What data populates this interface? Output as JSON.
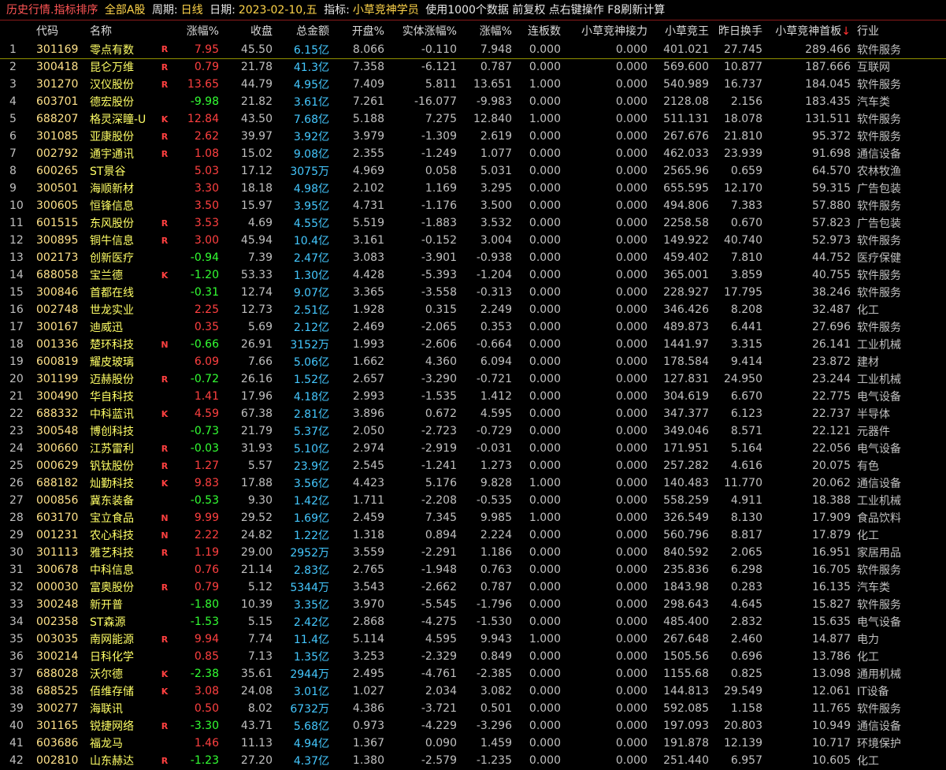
{
  "title_bar": {
    "history": "历史行情.指标排序",
    "market": "全部A股",
    "period_label": "周期:",
    "period_value": "日线",
    "date_label": "日期:",
    "date_value": "2023-02-10,五",
    "indicator_label": "指标:",
    "indicator_value": "小草竞神学员",
    "info": "使用1000个数据 前复权 点右键操作 F8刷新计算"
  },
  "columns": [
    "",
    "代码",
    "名称",
    "",
    "涨幅%",
    "收盘",
    "总金额",
    "开盘%",
    "实体涨幅%",
    "涨幅%",
    "连板数",
    "小草竞神接力",
    "小草竞王",
    "昨日换手",
    "小草竞神首板",
    "行业"
  ],
  "sort_indicator": "↓",
  "rows": [
    [
      "1",
      "301169",
      "零点有数",
      "R",
      "7.95",
      "45.50",
      "6.15亿",
      "8.066",
      "-0.110",
      "7.948",
      "0.000",
      "0.000",
      "401.021",
      "27.745",
      "289.466",
      "软件服务"
    ],
    [
      "2",
      "300418",
      "昆仑万维",
      "R",
      "0.79",
      "21.78",
      "41.3亿",
      "7.358",
      "-6.121",
      "0.787",
      "0.000",
      "0.000",
      "569.600",
      "10.877",
      "187.666",
      "互联网"
    ],
    [
      "3",
      "301270",
      "汉仪股份",
      "R",
      "13.65",
      "44.79",
      "4.95亿",
      "7.409",
      "5.811",
      "13.651",
      "1.000",
      "0.000",
      "540.989",
      "16.737",
      "184.045",
      "软件服务"
    ],
    [
      "4",
      "603701",
      "德宏股份",
      "",
      "-9.98",
      "21.82",
      "3.61亿",
      "7.261",
      "-16.077",
      "-9.983",
      "0.000",
      "0.000",
      "2128.08",
      "2.156",
      "183.435",
      "汽车类"
    ],
    [
      "5",
      "688207",
      "格灵深瞳-U",
      "K",
      "12.84",
      "43.50",
      "7.68亿",
      "5.188",
      "7.275",
      "12.840",
      "1.000",
      "0.000",
      "511.131",
      "18.078",
      "131.511",
      "软件服务"
    ],
    [
      "6",
      "301085",
      "亚康股份",
      "R",
      "2.62",
      "39.97",
      "3.92亿",
      "3.979",
      "-1.309",
      "2.619",
      "0.000",
      "0.000",
      "267.676",
      "21.810",
      "95.372",
      "软件服务"
    ],
    [
      "7",
      "002792",
      "通宇通讯",
      "R",
      "1.08",
      "15.02",
      "9.08亿",
      "2.355",
      "-1.249",
      "1.077",
      "0.000",
      "0.000",
      "462.033",
      "23.939",
      "91.698",
      "通信设备"
    ],
    [
      "8",
      "600265",
      "ST景谷",
      "",
      "5.03",
      "17.12",
      "3075万",
      "4.969",
      "0.058",
      "5.031",
      "0.000",
      "0.000",
      "2565.96",
      "0.659",
      "64.570",
      "农林牧渔"
    ],
    [
      "9",
      "300501",
      "海顺新材",
      "",
      "3.30",
      "18.18",
      "4.98亿",
      "2.102",
      "1.169",
      "3.295",
      "0.000",
      "0.000",
      "655.595",
      "12.170",
      "59.315",
      "广告包装"
    ],
    [
      "10",
      "300605",
      "恒锋信息",
      "",
      "3.50",
      "15.97",
      "3.95亿",
      "4.731",
      "-1.176",
      "3.500",
      "0.000",
      "0.000",
      "494.806",
      "7.383",
      "57.880",
      "软件服务"
    ],
    [
      "11",
      "601515",
      "东风股份",
      "R",
      "3.53",
      "4.69",
      "4.55亿",
      "5.519",
      "-1.883",
      "3.532",
      "0.000",
      "0.000",
      "2258.58",
      "0.670",
      "57.823",
      "广告包装"
    ],
    [
      "12",
      "300895",
      "铜牛信息",
      "R",
      "3.00",
      "45.94",
      "10.4亿",
      "3.161",
      "-0.152",
      "3.004",
      "0.000",
      "0.000",
      "149.922",
      "40.740",
      "52.973",
      "软件服务"
    ],
    [
      "13",
      "002173",
      "创新医疗",
      "",
      "-0.94",
      "7.39",
      "2.47亿",
      "3.083",
      "-3.901",
      "-0.938",
      "0.000",
      "0.000",
      "459.402",
      "7.810",
      "44.752",
      "医疗保健"
    ],
    [
      "14",
      "688058",
      "宝兰德",
      "K",
      "-1.20",
      "53.33",
      "1.30亿",
      "4.428",
      "-5.393",
      "-1.204",
      "0.000",
      "0.000",
      "365.001",
      "3.859",
      "40.755",
      "软件服务"
    ],
    [
      "15",
      "300846",
      "首都在线",
      "",
      "-0.31",
      "12.74",
      "9.07亿",
      "3.365",
      "-3.558",
      "-0.313",
      "0.000",
      "0.000",
      "228.927",
      "17.795",
      "38.246",
      "软件服务"
    ],
    [
      "16",
      "002748",
      "世龙实业",
      "",
      "2.25",
      "12.73",
      "2.51亿",
      "1.928",
      "0.315",
      "2.249",
      "0.000",
      "0.000",
      "346.426",
      "8.208",
      "32.487",
      "化工"
    ],
    [
      "17",
      "300167",
      "迪威迅",
      "",
      "0.35",
      "5.69",
      "2.12亿",
      "2.469",
      "-2.065",
      "0.353",
      "0.000",
      "0.000",
      "489.873",
      "6.441",
      "27.696",
      "软件服务"
    ],
    [
      "18",
      "001336",
      "楚环科技",
      "N",
      "-0.66",
      "26.91",
      "3152万",
      "1.993",
      "-2.606",
      "-0.664",
      "0.000",
      "0.000",
      "1441.97",
      "3.315",
      "26.141",
      "工业机械"
    ],
    [
      "19",
      "600819",
      "耀皮玻璃",
      "",
      "6.09",
      "7.66",
      "5.06亿",
      "1.662",
      "4.360",
      "6.094",
      "0.000",
      "0.000",
      "178.584",
      "9.414",
      "23.872",
      "建材"
    ],
    [
      "20",
      "301199",
      "迈赫股份",
      "R",
      "-0.72",
      "26.16",
      "1.52亿",
      "2.657",
      "-3.290",
      "-0.721",
      "0.000",
      "0.000",
      "127.831",
      "24.950",
      "23.244",
      "工业机械"
    ],
    [
      "21",
      "300490",
      "华自科技",
      "",
      "1.41",
      "17.96",
      "4.18亿",
      "2.993",
      "-1.535",
      "1.412",
      "0.000",
      "0.000",
      "304.619",
      "6.670",
      "22.775",
      "电气设备"
    ],
    [
      "22",
      "688332",
      "中科蓝讯",
      "K",
      "4.59",
      "67.38",
      "2.81亿",
      "3.896",
      "0.672",
      "4.595",
      "0.000",
      "0.000",
      "347.377",
      "6.123",
      "22.737",
      "半导体"
    ],
    [
      "23",
      "300548",
      "博创科技",
      "",
      "-0.73",
      "21.79",
      "5.37亿",
      "2.050",
      "-2.723",
      "-0.729",
      "0.000",
      "0.000",
      "349.046",
      "8.571",
      "22.121",
      "元器件"
    ],
    [
      "24",
      "300660",
      "江苏雷利",
      "R",
      "-0.03",
      "31.93",
      "5.10亿",
      "2.974",
      "-2.919",
      "-0.031",
      "0.000",
      "0.000",
      "171.951",
      "5.164",
      "22.056",
      "电气设备"
    ],
    [
      "25",
      "000629",
      "钒钛股份",
      "R",
      "1.27",
      "5.57",
      "23.9亿",
      "2.545",
      "-1.241",
      "1.273",
      "0.000",
      "0.000",
      "257.282",
      "4.616",
      "20.075",
      "有色"
    ],
    [
      "26",
      "688182",
      "灿勤科技",
      "K",
      "9.83",
      "17.88",
      "3.56亿",
      "4.423",
      "5.176",
      "9.828",
      "1.000",
      "0.000",
      "140.483",
      "11.770",
      "20.062",
      "通信设备"
    ],
    [
      "27",
      "000856",
      "冀东装备",
      "",
      "-0.53",
      "9.30",
      "1.42亿",
      "1.711",
      "-2.208",
      "-0.535",
      "0.000",
      "0.000",
      "558.259",
      "4.911",
      "18.388",
      "工业机械"
    ],
    [
      "28",
      "603170",
      "宝立食品",
      "N",
      "9.99",
      "29.52",
      "1.69亿",
      "2.459",
      "7.345",
      "9.985",
      "1.000",
      "0.000",
      "326.549",
      "8.130",
      "17.909",
      "食品饮料"
    ],
    [
      "29",
      "001231",
      "农心科技",
      "N",
      "2.22",
      "24.82",
      "1.22亿",
      "1.318",
      "0.894",
      "2.224",
      "0.000",
      "0.000",
      "560.796",
      "8.817",
      "17.879",
      "化工"
    ],
    [
      "30",
      "301113",
      "雅艺科技",
      "R",
      "1.19",
      "29.00",
      "2952万",
      "3.559",
      "-2.291",
      "1.186",
      "0.000",
      "0.000",
      "840.592",
      "2.065",
      "16.951",
      "家居用品"
    ],
    [
      "31",
      "300678",
      "中科信息",
      "",
      "0.76",
      "21.14",
      "2.83亿",
      "2.765",
      "-1.948",
      "0.763",
      "0.000",
      "0.000",
      "235.836",
      "6.298",
      "16.705",
      "软件服务"
    ],
    [
      "32",
      "000030",
      "富奥股份",
      "R",
      "0.79",
      "5.12",
      "5344万",
      "3.543",
      "-2.662",
      "0.787",
      "0.000",
      "0.000",
      "1843.98",
      "0.283",
      "16.135",
      "汽车类"
    ],
    [
      "33",
      "300248",
      "新开普",
      "",
      "-1.80",
      "10.39",
      "3.35亿",
      "3.970",
      "-5.545",
      "-1.796",
      "0.000",
      "0.000",
      "298.643",
      "4.645",
      "15.827",
      "软件服务"
    ],
    [
      "34",
      "002358",
      "ST森源",
      "",
      "-1.53",
      "5.15",
      "2.42亿",
      "2.868",
      "-4.275",
      "-1.530",
      "0.000",
      "0.000",
      "485.400",
      "2.832",
      "15.635",
      "电气设备"
    ],
    [
      "35",
      "003035",
      "南网能源",
      "R",
      "9.94",
      "7.74",
      "11.4亿",
      "5.114",
      "4.595",
      "9.943",
      "1.000",
      "0.000",
      "267.648",
      "2.460",
      "14.877",
      "电力"
    ],
    [
      "36",
      "300214",
      "日科化学",
      "",
      "0.85",
      "7.13",
      "1.35亿",
      "3.253",
      "-2.329",
      "0.849",
      "0.000",
      "0.000",
      "1505.56",
      "0.696",
      "13.786",
      "化工"
    ],
    [
      "37",
      "688028",
      "沃尔德",
      "K",
      "-2.38",
      "35.61",
      "2944万",
      "2.495",
      "-4.761",
      "-2.385",
      "0.000",
      "0.000",
      "1155.68",
      "0.825",
      "13.098",
      "通用机械"
    ],
    [
      "38",
      "688525",
      "佰维存储",
      "K",
      "3.08",
      "24.08",
      "3.01亿",
      "1.027",
      "2.034",
      "3.082",
      "0.000",
      "0.000",
      "144.813",
      "29.549",
      "12.061",
      "IT设备"
    ],
    [
      "39",
      "300277",
      "海联讯",
      "",
      "0.50",
      "8.02",
      "6732万",
      "4.386",
      "-3.721",
      "0.501",
      "0.000",
      "0.000",
      "592.085",
      "1.158",
      "11.765",
      "软件服务"
    ],
    [
      "40",
      "301165",
      "锐捷网络",
      "R",
      "-3.30",
      "43.71",
      "5.68亿",
      "0.973",
      "-4.229",
      "-3.296",
      "0.000",
      "0.000",
      "197.093",
      "20.803",
      "10.949",
      "通信设备"
    ],
    [
      "41",
      "603686",
      "福龙马",
      "",
      "1.46",
      "11.13",
      "4.94亿",
      "1.367",
      "0.090",
      "1.459",
      "0.000",
      "0.000",
      "191.878",
      "12.139",
      "10.717",
      "环境保护"
    ],
    [
      "42",
      "002810",
      "山东赫达",
      "R",
      "-1.23",
      "27.20",
      "4.37亿",
      "1.380",
      "-2.579",
      "-1.235",
      "0.000",
      "0.000",
      "251.440",
      "6.957",
      "10.605",
      "化工"
    ]
  ]
}
